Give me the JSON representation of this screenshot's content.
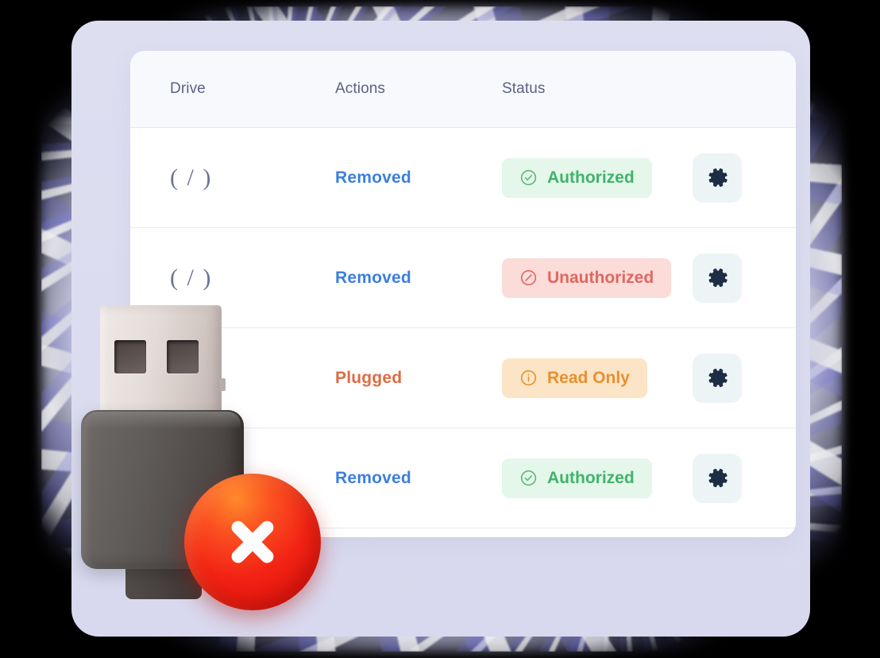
{
  "table": {
    "columns": [
      {
        "key": "drive",
        "label": "Drive"
      },
      {
        "key": "actions",
        "label": "Actions"
      },
      {
        "key": "status",
        "label": "Status"
      }
    ],
    "rows": [
      {
        "drive": "( / )",
        "action": "Removed",
        "action_color": "#3b7fde",
        "status": "Authorized",
        "status_icon": "check-circle-icon",
        "status_bg": "#e4f7ea",
        "status_color": "#41b36b",
        "settings_icon": "gear-icon"
      },
      {
        "drive": "( / )",
        "action": "Removed",
        "action_color": "#3b7fde",
        "status": "Unauthorized",
        "status_icon": "prohibited-circle-icon",
        "status_bg": "#fbdcd9",
        "status_color": "#e0675e",
        "settings_icon": "gear-icon"
      },
      {
        "drive": "",
        "action": "Plugged",
        "action_color": "#dd6c43",
        "status": "Read Only",
        "status_icon": "info-circle-icon",
        "status_bg": "#fce5c6",
        "status_color": "#e8902f",
        "settings_icon": "gear-icon"
      },
      {
        "drive": "",
        "action": "Removed",
        "action_color": "#3b7fde",
        "status": "Authorized",
        "status_icon": "check-circle-icon",
        "status_bg": "#e4f7ea",
        "status_color": "#41b36b",
        "settings_icon": "gear-icon"
      }
    ]
  },
  "illustration": {
    "name": "usb-flash-drive-3d",
    "error_badge_icon": "red-x-circle-icon",
    "connector_color": "#e4dcd8",
    "body_color": "#5f5b59",
    "error_color": "#f32415"
  },
  "theme": {
    "card_bg": "#ffffff",
    "header_bg": "#f8f9fd",
    "panel_bg": "#dedef1",
    "header_text": "#5c6183",
    "divider": "#e9e9f3",
    "gear_btn_bg": "#edf4f6",
    "gear_color": "#1d2d44",
    "drive_glyph_color": "#6b7094"
  }
}
